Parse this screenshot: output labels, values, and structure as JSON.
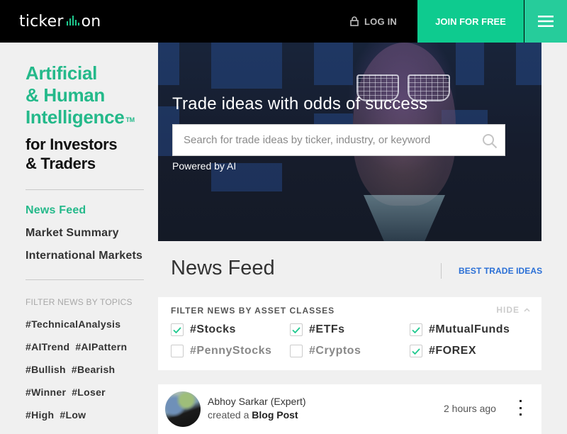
{
  "header": {
    "logo_left": "ticker",
    "logo_right": "on",
    "login_label": "LOG IN",
    "join_label": "JOIN FOR FREE",
    "brand_color": "#0ecb8f"
  },
  "sidebar": {
    "tagline_green": [
      "Artificial",
      "& Human",
      "Intelligence"
    ],
    "trademark": "TM",
    "tagline_dark": [
      "for Investors",
      "& Traders"
    ],
    "nav": [
      {
        "label": "News Feed",
        "active": true
      },
      {
        "label": "Market Summary",
        "active": false
      },
      {
        "label": "International Markets",
        "active": false
      }
    ],
    "topics_label": "FILTER NEWS BY TOPICS",
    "topic_rows": [
      [
        "#TechnicalAnalysis"
      ],
      [
        "#AITrend",
        "#AIPattern"
      ],
      [
        "#Bullish",
        "#Bearish"
      ],
      [
        "#Winner",
        "#Loser"
      ],
      [
        "#High",
        "#Low"
      ]
    ]
  },
  "hero": {
    "title": "Trade ideas with odds of success",
    "search_placeholder": "Search for trade ideas by ticker, industry, or keyword",
    "search_value": "",
    "powered_by": "Powered by AI"
  },
  "main": {
    "title": "News Feed",
    "best_link": "BEST TRADE IDEAS",
    "filter": {
      "title": "FILTER NEWS BY ASSET CLASSES",
      "hide_label": "HIDE",
      "options": [
        {
          "label": "#Stocks",
          "checked": true
        },
        {
          "label": "#ETFs",
          "checked": true
        },
        {
          "label": "#MutualFunds",
          "checked": true
        },
        {
          "label": "#PennyStocks",
          "checked": false
        },
        {
          "label": "#Cryptos",
          "checked": false
        },
        {
          "label": "#FOREX",
          "checked": true
        }
      ]
    },
    "post": {
      "author": "Abhoy Sarkar (Expert)",
      "action_prefix": "created a",
      "action_type": "Blog Post",
      "time": "2 hours ago"
    }
  }
}
